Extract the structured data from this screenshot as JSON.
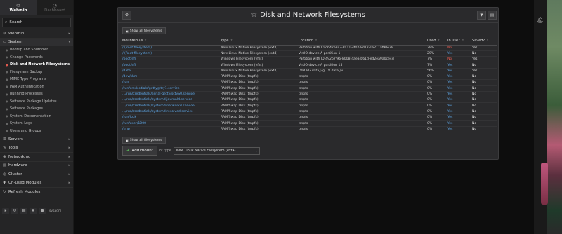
{
  "sidebar": {
    "tabs": [
      {
        "label": "Webmin",
        "icon": "webmin-logo-icon"
      },
      {
        "label": "Dashboard",
        "icon": "dashboard-icon"
      }
    ],
    "search_placeholder": "Search",
    "categories_top": [
      {
        "label": "Webmin",
        "icon": "gear-icon"
      }
    ],
    "system": {
      "label": "System",
      "items": [
        "Bootup and Shutdown",
        "Change Passwords",
        "Disk and Network Filesystems",
        "Filesystem Backup",
        "MIME Type Programs",
        "PAM Authentication",
        "Running Processes",
        "Software Package Updates",
        "Software Packages",
        "System Documentation",
        "System Logs",
        "Users and Groups"
      ],
      "active_index": 2
    },
    "categories_bottom": [
      {
        "label": "Servers"
      },
      {
        "label": "Tools"
      },
      {
        "label": "Networking"
      },
      {
        "label": "Hardware"
      },
      {
        "label": "Cluster"
      },
      {
        "label": "Un-used Modules"
      },
      {
        "label": "Refresh Modules"
      }
    ],
    "footer_user": "sysadm"
  },
  "panel": {
    "title": "Disk and Network Filesystems",
    "show_all_label": "Show all filesystems",
    "columns": [
      "Mounted as",
      "Type",
      "Location",
      "Used",
      "In use?",
      "Saved?"
    ],
    "rows": [
      [
        "/ (Root filesystem)",
        "New Linux Native Filesystem (ext4)",
        "Partition with ID d642e8c3-8a11-4f02-8d12-1a211af90e29",
        "29%",
        "No",
        "Yes"
      ],
      [
        "/ (Root filesystem)",
        "New Linux Native Filesystem (ext4)",
        "VirtIO device A partition 1",
        "29%",
        "Yes",
        "No"
      ],
      [
        "/boot/efi",
        "Windows Filesystem (vfat)",
        "Partition with ID 492b7f96-8008-4aea-b61d-ed2ea9a0ce4d",
        "7%",
        "No",
        "Yes"
      ],
      [
        "/boot/efi",
        "Windows Filesystem (vfat)",
        "VirtIO device A partition 15",
        "7%",
        "Yes",
        "No"
      ],
      [
        "/data",
        "New Linux Native Filesystem (ext4)",
        "LVM VG data_vg, LV data_lv",
        "56%",
        "Yes",
        "Yes"
      ],
      [
        "/dev/shm",
        "RAM/Swap Disk (tmpfs)",
        "tmpfs",
        "0%",
        "Yes",
        "No"
      ],
      [
        "/run",
        "RAM/Swap Disk (tmpfs)",
        "tmpfs",
        "0%",
        "Yes",
        "No"
      ],
      [
        "/run/credentials/getty@tty1.service",
        "RAM/Swap Disk (tmpfs)",
        "tmpfs",
        "0%",
        "Yes",
        "No"
      ],
      [
        ".../run/credentials/serial-getty@ttyS0.service",
        "RAM/Swap Disk (tmpfs)",
        "tmpfs",
        "0%",
        "Yes",
        "No"
      ],
      [
        ".../run/credentials/systemd-journald.service",
        "RAM/Swap Disk (tmpfs)",
        "tmpfs",
        "0%",
        "Yes",
        "No"
      ],
      [
        ".../run/credentials/systemd-networkd.service",
        "RAM/Swap Disk (tmpfs)",
        "tmpfs",
        "0%",
        "Yes",
        "No"
      ],
      [
        ".../run/credentials/systemd-resolved.service",
        "RAM/Swap Disk (tmpfs)",
        "tmpfs",
        "0%",
        "Yes",
        "No"
      ],
      [
        "/run/lock",
        "RAM/Swap Disk (tmpfs)",
        "tmpfs",
        "0%",
        "Yes",
        "No"
      ],
      [
        "/run/user/1000",
        "RAM/Swap Disk (tmpfs)",
        "tmpfs",
        "0%",
        "Yes",
        "No"
      ],
      [
        "/tmp",
        "RAM/Swap Disk (tmpfs)",
        "tmpfs",
        "0%",
        "Yes",
        "No"
      ]
    ],
    "add_mount_label": "Add mount",
    "of_type_label": "of type",
    "type_selected": "New Linux Native Filesystem (ext4)"
  },
  "colors": {
    "link": "#5fa8e8",
    "no_red": "#e25b50",
    "active_marker": "#e05a4f"
  }
}
